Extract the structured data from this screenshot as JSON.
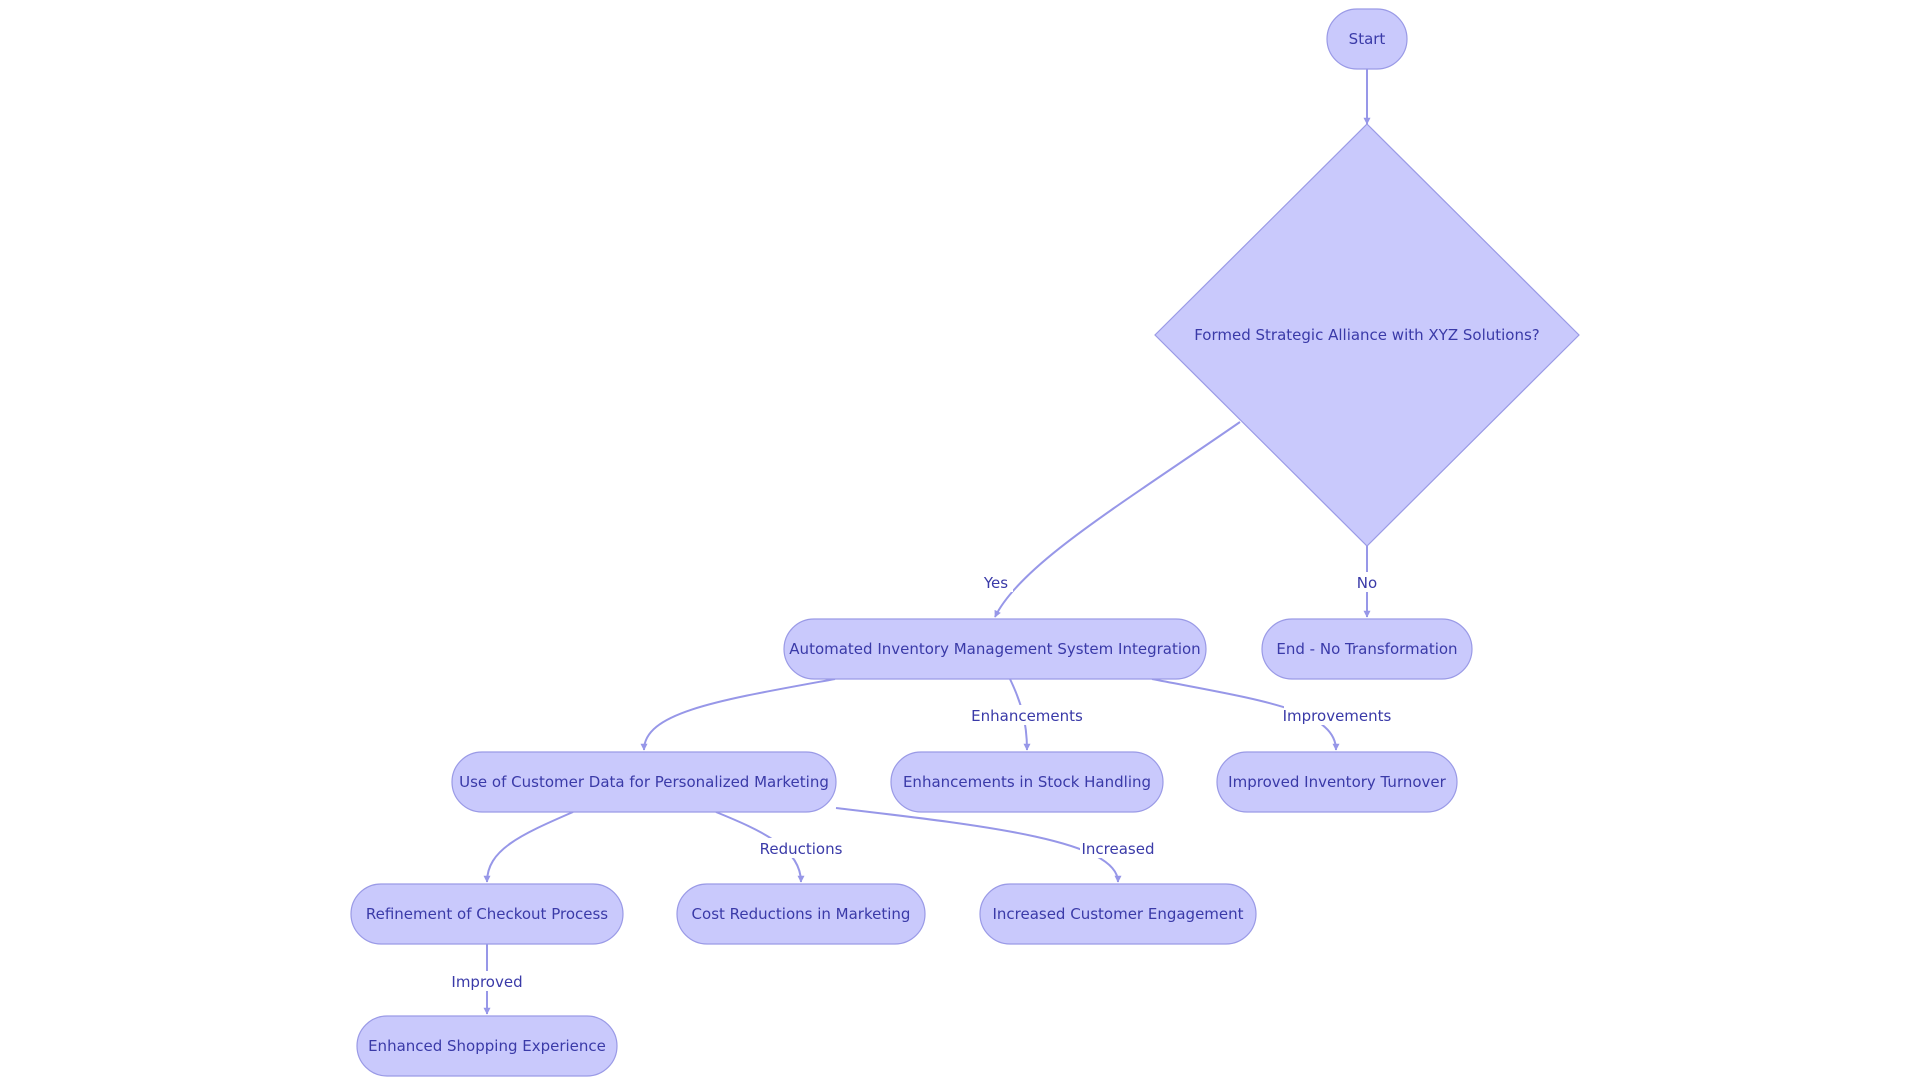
{
  "colors": {
    "node_fill": "#c9c9fc",
    "node_stroke": "#9a9ae6",
    "edge": "#9797e8",
    "text": "#3a3aa8",
    "background": "#ffffff"
  },
  "nodes": [
    {
      "id": "start",
      "label": "Start",
      "shape": "rounded"
    },
    {
      "id": "decision",
      "label": "Formed Strategic Alliance with XYZ Solutions?",
      "shape": "diamond"
    },
    {
      "id": "automated",
      "label": "Automated Inventory Management System Integration",
      "shape": "rounded"
    },
    {
      "id": "end",
      "label": "End - No Transformation",
      "shape": "rounded"
    },
    {
      "id": "customer_data",
      "label": "Use of Customer Data for Personalized Marketing",
      "shape": "rounded"
    },
    {
      "id": "stock",
      "label": "Enhancements in Stock Handling",
      "shape": "rounded"
    },
    {
      "id": "turnover",
      "label": "Improved Inventory Turnover",
      "shape": "rounded"
    },
    {
      "id": "checkout",
      "label": "Refinement of Checkout Process",
      "shape": "rounded"
    },
    {
      "id": "cost",
      "label": "Cost Reductions in Marketing",
      "shape": "rounded"
    },
    {
      "id": "engagement",
      "label": "Increased Customer Engagement",
      "shape": "rounded"
    },
    {
      "id": "shopping",
      "label": "Enhanced Shopping Experience",
      "shape": "rounded"
    }
  ],
  "edges": [
    {
      "from": "start",
      "to": "decision",
      "label": ""
    },
    {
      "from": "decision",
      "to": "automated",
      "label": "Yes"
    },
    {
      "from": "decision",
      "to": "end",
      "label": "No"
    },
    {
      "from": "automated",
      "to": "customer_data",
      "label": ""
    },
    {
      "from": "automated",
      "to": "stock",
      "label": "Enhancements"
    },
    {
      "from": "automated",
      "to": "turnover",
      "label": "Improvements"
    },
    {
      "from": "customer_data",
      "to": "checkout",
      "label": ""
    },
    {
      "from": "customer_data",
      "to": "cost",
      "label": "Reductions"
    },
    {
      "from": "customer_data",
      "to": "engagement",
      "label": "Increased"
    },
    {
      "from": "checkout",
      "to": "shopping",
      "label": "Improved"
    }
  ]
}
